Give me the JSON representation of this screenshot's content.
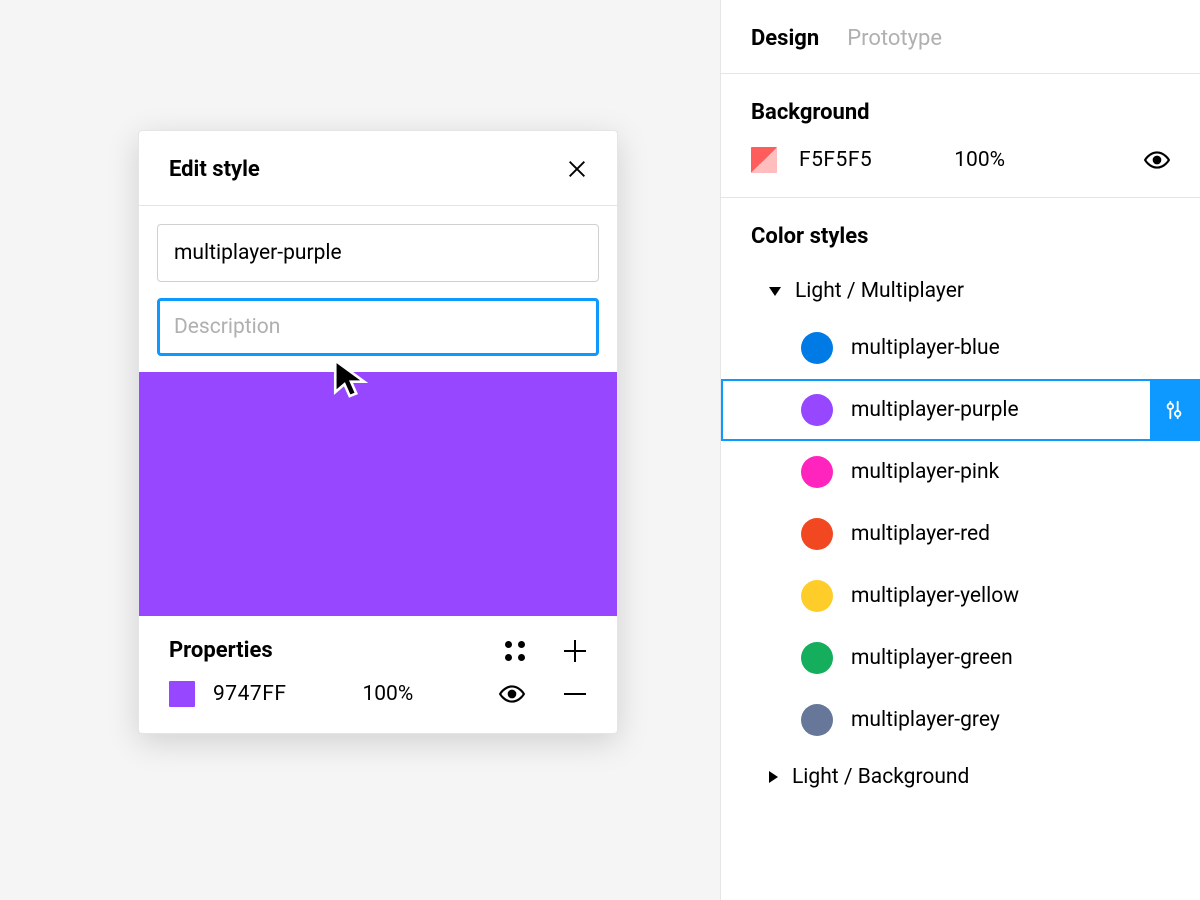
{
  "modal": {
    "title": "Edit style",
    "name_input": "multiplayer-purple",
    "description_placeholder": "Description",
    "description_value": "",
    "preview_color": "#9747FF",
    "properties_heading": "Properties",
    "property": {
      "hex": "9747FF",
      "opacity": "100%",
      "swatch": "#9747FF"
    }
  },
  "sidebar": {
    "tabs": [
      {
        "label": "Design",
        "active": true
      },
      {
        "label": "Prototype",
        "active": false
      }
    ],
    "background": {
      "heading": "Background",
      "hex": "F5F5F5",
      "opacity": "100%",
      "swatch_a": "#ff5c5c",
      "swatch_b": "#ffbdbd"
    },
    "color_styles_heading": "Color styles",
    "groups": [
      {
        "name": "Light / Multiplayer",
        "open": true,
        "items": [
          {
            "label": "multiplayer-blue",
            "color": "#007BE5",
            "selected": false
          },
          {
            "label": "multiplayer-purple",
            "color": "#9747FF",
            "selected": true
          },
          {
            "label": "multiplayer-pink",
            "color": "#FF24BD",
            "selected": false
          },
          {
            "label": "multiplayer-red",
            "color": "#F24822",
            "selected": false
          },
          {
            "label": "multiplayer-yellow",
            "color": "#FFCD29",
            "selected": false
          },
          {
            "label": "multiplayer-green",
            "color": "#14AE5C",
            "selected": false
          },
          {
            "label": "multiplayer-grey",
            "color": "#667799",
            "selected": false
          }
        ]
      },
      {
        "name": "Light / Background",
        "open": false,
        "items": []
      }
    ]
  }
}
